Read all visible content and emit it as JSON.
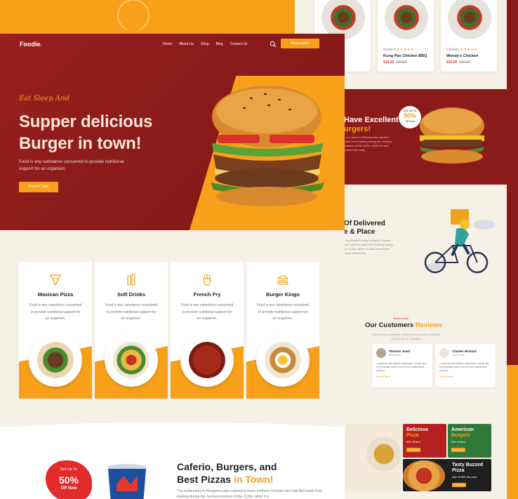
{
  "brand": {
    "name": "Foodie",
    "dot": "."
  },
  "colors": {
    "primary": "#8b1a1a",
    "accent": "#f8a01a",
    "cream": "#f6f1e7"
  },
  "nav": {
    "links": [
      "Home",
      "About Us",
      "Shop",
      "Blog",
      "Contact Us"
    ],
    "reservation": "Reservation"
  },
  "hero": {
    "kicker": "Eat Sleep And",
    "title_line1": "Supper delicious",
    "title_line2": "Burger in town!",
    "description": "Food is any substance consumed to provide nutritional support for an organism.",
    "cta": "Book A Table"
  },
  "categories": [
    {
      "title": "Maxican Pizza",
      "desc": "Food is any substance consumed to provide nutritional support for an organism.",
      "icon": "pizza-slice-icon"
    },
    {
      "title": "Soft Drinks",
      "desc": "Food is any substance consumed to provide nutritional support for an organism.",
      "icon": "drinks-icon"
    },
    {
      "title": "French Fry",
      "desc": "Food is any substance consumed to provide nutritional support for an organism.",
      "icon": "fries-icon"
    },
    {
      "title": "Burger Kingo",
      "desc": "Food is any substance consumed to provide nutritional support for an organism.",
      "icon": "burger-icon"
    }
  ],
  "about": {
    "badge_top": "Get Up To",
    "badge_value": "50%",
    "badge_bottom": "Off Now",
    "title_line1": "Caferio, Burgers, and",
    "title_line2": "Best Pizzas",
    "title_highlight": "in Town!",
    "text": "The restaurants in Hangzhou also catered to many northern Chinese who had fled south from Kaifeng during the Jurchen invasion of the 1120s, while it is"
  },
  "right": {
    "products": [
      {
        "cat": "",
        "name": "",
        "price": "",
        "old": ""
      },
      {
        "cat": "Burgers",
        "name": "Kung Pao Chicken BBQ",
        "price": "$14.00",
        "old": "$20.00"
      },
      {
        "cat": "Chicken",
        "name": "Wendy's Chicken",
        "price": "$10.00",
        "old": "$20.00"
      }
    ],
    "promo": {
      "line1": "Have Excellent",
      "line2": "urgers!",
      "text": "...in 1 serve a Chinese who had fled south from Kaifeng during the Jurchen invasion of the 1120s, while it is also known that many",
      "badge_top": "Get Up To",
      "badge_value": "50%",
      "badge_bottom": "Off Now"
    },
    "delivery": {
      "line1": "Of Delivered",
      "line2": "e & Place",
      "text": "...ve served a many northern Chinese who had fled south from Kaifeng during the 1120s, while it is also known that many restaurants."
    },
    "reviews": {
      "kicker": "Testimonials",
      "title": "Our Customers",
      "title_highlight": "Reviews",
      "sub": "Food is any substance consumed to provide nutritional support for an organism.",
      "items": [
        {
          "name": "",
          "role": "",
          "quote": "...l lorem ipsum sit without restaurant. I would like to personally thank you for your outstanding product."
        },
        {
          "name": "Thomas Josef",
          "role": "Restaurant",
          "quote": "I would be lost without restaurant. I would like to personally thank you for your outstanding product."
        },
        {
          "name": "Charles Richard",
          "role": "Food Lover",
          "quote": "I would be lost without restaurant. I would like to personally thank you for your outstanding product."
        }
      ],
      "stars": "★★★★★"
    },
    "menu": [
      {
        "l1": "Delicious",
        "l2": "Pizza",
        "sub": "50% off Now",
        "btn": "Order Now"
      },
      {
        "l1": "American",
        "l2": "Burgers",
        "sub": "50% off Now",
        "btn": "Order Now"
      },
      {
        "l1": "Tasty Buzzed",
        "l2": "Pizza",
        "sub": "Sale off 50% this week",
        "btn": "Order Now"
      }
    ]
  }
}
